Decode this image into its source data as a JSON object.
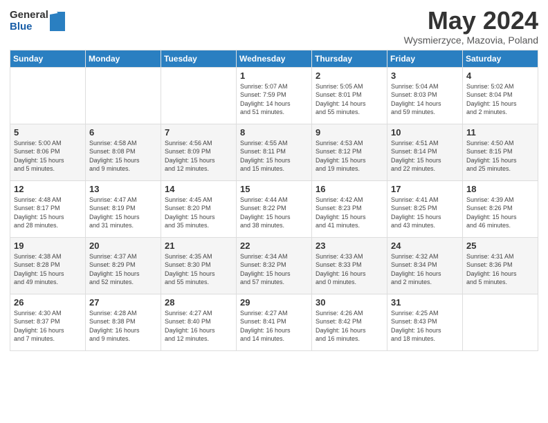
{
  "logo": {
    "general": "General",
    "blue": "Blue"
  },
  "title": "May 2024",
  "subtitle": "Wysmierzyce, Mazovia, Poland",
  "days_of_week": [
    "Sunday",
    "Monday",
    "Tuesday",
    "Wednesday",
    "Thursday",
    "Friday",
    "Saturday"
  ],
  "weeks": [
    [
      {
        "day": "",
        "info": ""
      },
      {
        "day": "",
        "info": ""
      },
      {
        "day": "",
        "info": ""
      },
      {
        "day": "1",
        "info": "Sunrise: 5:07 AM\nSunset: 7:59 PM\nDaylight: 14 hours\nand 51 minutes."
      },
      {
        "day": "2",
        "info": "Sunrise: 5:05 AM\nSunset: 8:01 PM\nDaylight: 14 hours\nand 55 minutes."
      },
      {
        "day": "3",
        "info": "Sunrise: 5:04 AM\nSunset: 8:03 PM\nDaylight: 14 hours\nand 59 minutes."
      },
      {
        "day": "4",
        "info": "Sunrise: 5:02 AM\nSunset: 8:04 PM\nDaylight: 15 hours\nand 2 minutes."
      }
    ],
    [
      {
        "day": "5",
        "info": "Sunrise: 5:00 AM\nSunset: 8:06 PM\nDaylight: 15 hours\nand 5 minutes."
      },
      {
        "day": "6",
        "info": "Sunrise: 4:58 AM\nSunset: 8:08 PM\nDaylight: 15 hours\nand 9 minutes."
      },
      {
        "day": "7",
        "info": "Sunrise: 4:56 AM\nSunset: 8:09 PM\nDaylight: 15 hours\nand 12 minutes."
      },
      {
        "day": "8",
        "info": "Sunrise: 4:55 AM\nSunset: 8:11 PM\nDaylight: 15 hours\nand 15 minutes."
      },
      {
        "day": "9",
        "info": "Sunrise: 4:53 AM\nSunset: 8:12 PM\nDaylight: 15 hours\nand 19 minutes."
      },
      {
        "day": "10",
        "info": "Sunrise: 4:51 AM\nSunset: 8:14 PM\nDaylight: 15 hours\nand 22 minutes."
      },
      {
        "day": "11",
        "info": "Sunrise: 4:50 AM\nSunset: 8:15 PM\nDaylight: 15 hours\nand 25 minutes."
      }
    ],
    [
      {
        "day": "12",
        "info": "Sunrise: 4:48 AM\nSunset: 8:17 PM\nDaylight: 15 hours\nand 28 minutes."
      },
      {
        "day": "13",
        "info": "Sunrise: 4:47 AM\nSunset: 8:19 PM\nDaylight: 15 hours\nand 31 minutes."
      },
      {
        "day": "14",
        "info": "Sunrise: 4:45 AM\nSunset: 8:20 PM\nDaylight: 15 hours\nand 35 minutes."
      },
      {
        "day": "15",
        "info": "Sunrise: 4:44 AM\nSunset: 8:22 PM\nDaylight: 15 hours\nand 38 minutes."
      },
      {
        "day": "16",
        "info": "Sunrise: 4:42 AM\nSunset: 8:23 PM\nDaylight: 15 hours\nand 41 minutes."
      },
      {
        "day": "17",
        "info": "Sunrise: 4:41 AM\nSunset: 8:25 PM\nDaylight: 15 hours\nand 43 minutes."
      },
      {
        "day": "18",
        "info": "Sunrise: 4:39 AM\nSunset: 8:26 PM\nDaylight: 15 hours\nand 46 minutes."
      }
    ],
    [
      {
        "day": "19",
        "info": "Sunrise: 4:38 AM\nSunset: 8:28 PM\nDaylight: 15 hours\nand 49 minutes."
      },
      {
        "day": "20",
        "info": "Sunrise: 4:37 AM\nSunset: 8:29 PM\nDaylight: 15 hours\nand 52 minutes."
      },
      {
        "day": "21",
        "info": "Sunrise: 4:35 AM\nSunset: 8:30 PM\nDaylight: 15 hours\nand 55 minutes."
      },
      {
        "day": "22",
        "info": "Sunrise: 4:34 AM\nSunset: 8:32 PM\nDaylight: 15 hours\nand 57 minutes."
      },
      {
        "day": "23",
        "info": "Sunrise: 4:33 AM\nSunset: 8:33 PM\nDaylight: 16 hours\nand 0 minutes."
      },
      {
        "day": "24",
        "info": "Sunrise: 4:32 AM\nSunset: 8:34 PM\nDaylight: 16 hours\nand 2 minutes."
      },
      {
        "day": "25",
        "info": "Sunrise: 4:31 AM\nSunset: 8:36 PM\nDaylight: 16 hours\nand 5 minutes."
      }
    ],
    [
      {
        "day": "26",
        "info": "Sunrise: 4:30 AM\nSunset: 8:37 PM\nDaylight: 16 hours\nand 7 minutes."
      },
      {
        "day": "27",
        "info": "Sunrise: 4:28 AM\nSunset: 8:38 PM\nDaylight: 16 hours\nand 9 minutes."
      },
      {
        "day": "28",
        "info": "Sunrise: 4:27 AM\nSunset: 8:40 PM\nDaylight: 16 hours\nand 12 minutes."
      },
      {
        "day": "29",
        "info": "Sunrise: 4:27 AM\nSunset: 8:41 PM\nDaylight: 16 hours\nand 14 minutes."
      },
      {
        "day": "30",
        "info": "Sunrise: 4:26 AM\nSunset: 8:42 PM\nDaylight: 16 hours\nand 16 minutes."
      },
      {
        "day": "31",
        "info": "Sunrise: 4:25 AM\nSunset: 8:43 PM\nDaylight: 16 hours\nand 18 minutes."
      },
      {
        "day": "",
        "info": ""
      }
    ]
  ]
}
